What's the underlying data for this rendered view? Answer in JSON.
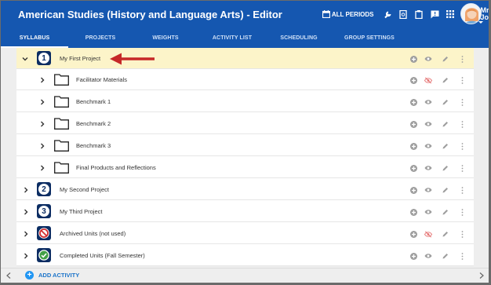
{
  "header": {
    "title": "American Studies (History and Language Arts) - Editor",
    "periods_label": "ALL PERIODS",
    "user_first": "Mrs.",
    "user_last": "Johnson"
  },
  "tabs": [
    {
      "label": "SYLLABUS",
      "active": true
    },
    {
      "label": "PROJECTS",
      "active": false
    },
    {
      "label": "WEIGHTS",
      "active": false
    },
    {
      "label": "ACTIVITY LIST",
      "active": false
    },
    {
      "label": "SCHEDULING",
      "active": false
    },
    {
      "label": "GROUP SETTINGS",
      "active": false
    }
  ],
  "rows": [
    {
      "label": "My First Project",
      "badge": "1",
      "kind": "number",
      "expanded": true,
      "hidden": false
    },
    {
      "label": "Facilitator Materials",
      "kind": "folder",
      "hidden": true
    },
    {
      "label": "Benchmark 1",
      "kind": "folder",
      "hidden": false
    },
    {
      "label": "Benchmark 2",
      "kind": "folder",
      "hidden": false
    },
    {
      "label": "Benchmark 3",
      "kind": "folder",
      "hidden": false
    },
    {
      "label": "Final Products and Reflections",
      "kind": "folder",
      "hidden": false
    },
    {
      "label": "My Second Project",
      "badge": "2",
      "kind": "number",
      "hidden": false
    },
    {
      "label": "My Third Project",
      "badge": "3",
      "kind": "number",
      "hidden": false
    },
    {
      "label": "Archived Units (not used)",
      "kind": "archived",
      "hidden": true
    },
    {
      "label": "Completed Units (Fall Semester)",
      "kind": "completed",
      "hidden": false
    }
  ],
  "footer": {
    "add_label": "ADD ACTIVITY"
  },
  "colors": {
    "header_bg": "#1557b0",
    "highlight_row": "#fcf4c9",
    "badge_bg": "#0c2d63",
    "accent": "#2196f3",
    "annotation_arrow": "#c62828"
  }
}
